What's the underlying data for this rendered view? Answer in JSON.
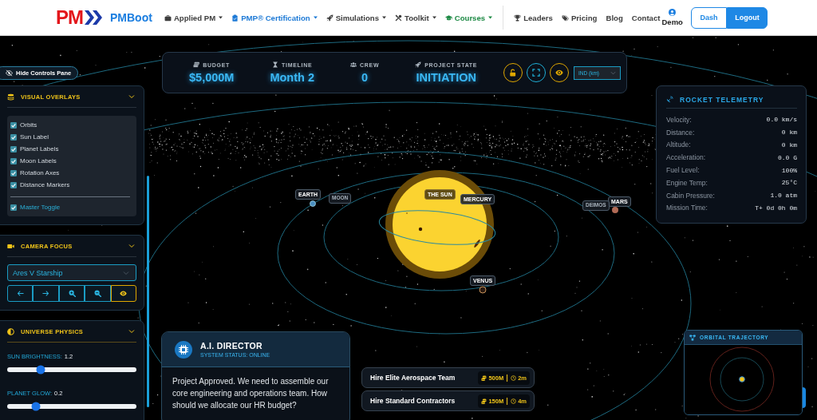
{
  "nav": {
    "logo_mark": "PM",
    "brand": "PMBoot",
    "menu": [
      {
        "label": "Applied PM",
        "dropdown": true,
        "color": "#3d3d3d"
      },
      {
        "label": "PMP® Certification",
        "dropdown": true,
        "color": "#1e7ad6"
      },
      {
        "label": "Simulations",
        "dropdown": true,
        "color": "#3d3d3d"
      },
      {
        "label": "Toolkit",
        "dropdown": true,
        "color": "#3d3d3d"
      },
      {
        "label": "Courses",
        "dropdown": true,
        "color": "#1e8a45"
      }
    ],
    "links": [
      {
        "label": "Leaders"
      },
      {
        "label": "Pricing"
      },
      {
        "label": "Blog"
      },
      {
        "label": "Contact"
      }
    ],
    "user": {
      "name": "Demo"
    },
    "buttons": [
      {
        "label": "Dash",
        "kind": "outline"
      },
      {
        "label": "Logout",
        "kind": "primary"
      }
    ]
  },
  "controls_toggle": {
    "label": "Hide Controls Pane"
  },
  "visual_overlays": {
    "title": "VISUAL OVERLAYS",
    "options": [
      {
        "label": "Orbits",
        "checked": true
      },
      {
        "label": "Sun Label",
        "checked": true
      },
      {
        "label": "Planet Labels",
        "checked": true
      },
      {
        "label": "Moon Labels",
        "checked": true
      },
      {
        "label": "Rotation Axes",
        "checked": true
      },
      {
        "label": "Distance Markers",
        "checked": true
      }
    ],
    "master": {
      "label": "Master Toggle",
      "checked": true
    }
  },
  "camera_focus": {
    "title": "CAMERA FOCUS",
    "target": "Ares V Starship",
    "buttons": [
      {
        "selected": false
      },
      {
        "selected": false
      },
      {
        "selected": false
      },
      {
        "selected": false
      },
      {
        "selected": true
      }
    ]
  },
  "universe_physics": {
    "title": "UNIVERSE PHYSICS",
    "sliders": [
      {
        "label": "SUN BRIGHTNESS:",
        "reading": "1.2",
        "level": 0.26
      },
      {
        "label": "PLANET GLOW:",
        "reading": "0.2",
        "level": 0.22
      }
    ]
  },
  "hud": {
    "stats": [
      {
        "label": "BUDGET",
        "value": "$5,000M"
      },
      {
        "label": "TIMELINE",
        "value": "Month 2"
      },
      {
        "label": "CREW",
        "value": "0"
      },
      {
        "label": "PROJECT STATE",
        "value": "INITIATION"
      }
    ],
    "tools": [
      {
        "color": "#e0a800"
      },
      {
        "color": "#1fb0d8"
      },
      {
        "color": "#e0a800"
      }
    ],
    "units": "IND (km)"
  },
  "scene": {
    "bodies": [
      {
        "label": "THE SUN",
        "kind": "star"
      },
      {
        "label": "MERCURY",
        "kind": "planet"
      },
      {
        "label": "EARTH",
        "kind": "planet"
      },
      {
        "label": "MOON",
        "kind": "moon"
      },
      {
        "label": "VENUS",
        "kind": "planet"
      },
      {
        "label": "MARS",
        "kind": "planet"
      },
      {
        "label": "DEIMOS",
        "kind": "moon"
      }
    ]
  },
  "telemetry": {
    "title": "ROCKET TELEMETRY",
    "rows": [
      {
        "label": "Velocity:",
        "value": "0.0 km/s"
      },
      {
        "label": "Distance:",
        "value": "0 km"
      },
      {
        "label": "Altitude:",
        "value": "0 km"
      },
      {
        "label": "Acceleration:",
        "value": "0.0 G"
      },
      {
        "label": "Fuel Level:",
        "value": "100%"
      },
      {
        "label": "Engine Temp:",
        "value": "25°C"
      },
      {
        "label": "Cabin Pressure:",
        "value": "1.0 atm"
      },
      {
        "label": "Mission Time:",
        "value": "T+ 0d 0h 0m"
      }
    ]
  },
  "director": {
    "title": "A.I. DIRECTOR",
    "status": "SYSTEM STATUS: ONLINE",
    "message": "Project Approved. We need to assemble our core engineering and operations team. How should we allocate our HR budget?"
  },
  "choices": [
    {
      "label": "Hire Elite Aerospace Team",
      "cost": "500M",
      "time": "2m"
    },
    {
      "label": "Hire Standard Contractors",
      "cost": "150M",
      "time": "4m"
    }
  ],
  "orbital_trajectory": {
    "title": "ORBITAL TRAJECTORY"
  }
}
